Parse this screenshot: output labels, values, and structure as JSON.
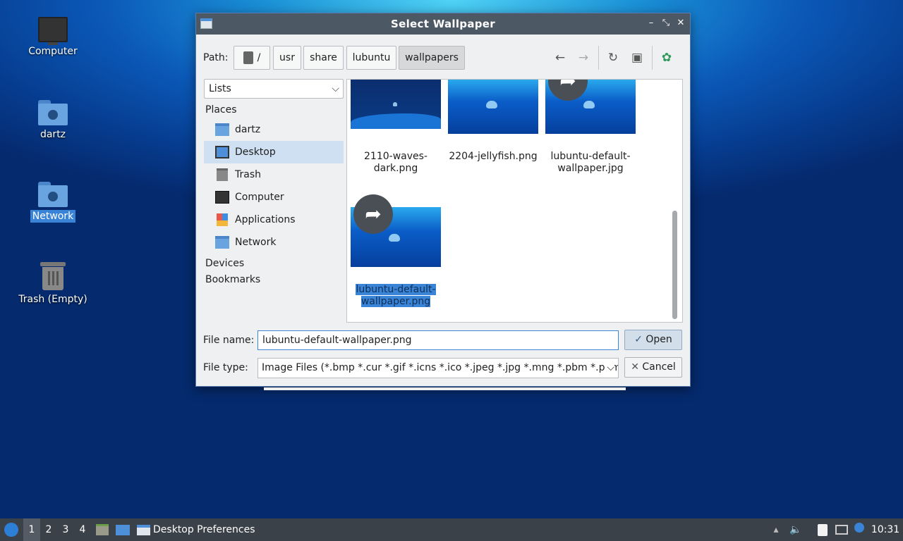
{
  "desktop": {
    "icons": [
      {
        "label": "Computer",
        "icon": "computer-icon"
      },
      {
        "label": "dartz",
        "icon": "home-folder-icon"
      },
      {
        "label": "Network",
        "icon": "network-folder-icon",
        "selected": true
      },
      {
        "label": "Trash (Empty)",
        "icon": "trash-icon"
      }
    ]
  },
  "dialog": {
    "title": "Select Wallpaper",
    "window_controls": {
      "minimize": "–",
      "maximize": "⤡",
      "close": "✕"
    },
    "path_label": "Path:",
    "breadcrumbs": [
      "/",
      "usr",
      "share",
      "lubuntu",
      "wallpapers"
    ],
    "active_crumb": "wallpapers",
    "view_mode": "Lists",
    "sidebar": {
      "places_title": "Places",
      "places": [
        {
          "label": "dartz",
          "icon": "home-folder-icon"
        },
        {
          "label": "Desktop",
          "icon": "desktop-icon",
          "selected": true
        },
        {
          "label": "Trash",
          "icon": "trash-icon"
        },
        {
          "label": "Computer",
          "icon": "computer-icon"
        },
        {
          "label": "Applications",
          "icon": "applications-icon"
        },
        {
          "label": "Network",
          "icon": "network-folder-icon"
        }
      ],
      "devices_title": "Devices",
      "bookmarks_title": "Bookmarks"
    },
    "files": [
      {
        "name_line1": "2110-waves-",
        "name_line2": "dark.png"
      },
      {
        "name_line1": "2204-jellyfish.png",
        "name_line2": ""
      },
      {
        "name_line1": "lubuntu-default-",
        "name_line2": "wallpaper.jpg"
      },
      {
        "name_line1": "lubuntu-default-",
        "name_line2": "wallpaper.png",
        "selected": true
      }
    ],
    "file_name_label": "File name:",
    "file_name_value": "lubuntu-default-wallpaper.png",
    "file_type_label": "File type:",
    "file_type_value": "Image Files (*.bmp *.cur *.gif *.icns *.ico *.jpeg *.jpg *.mng *.pbm *.pgm",
    "open_label": "Open",
    "cancel_label": "Cancel"
  },
  "taskbar": {
    "desktops": [
      "1",
      "2",
      "3",
      "4"
    ],
    "current_desktop": "1",
    "task_label": "Desktop Preferences",
    "clock": "10:31"
  }
}
